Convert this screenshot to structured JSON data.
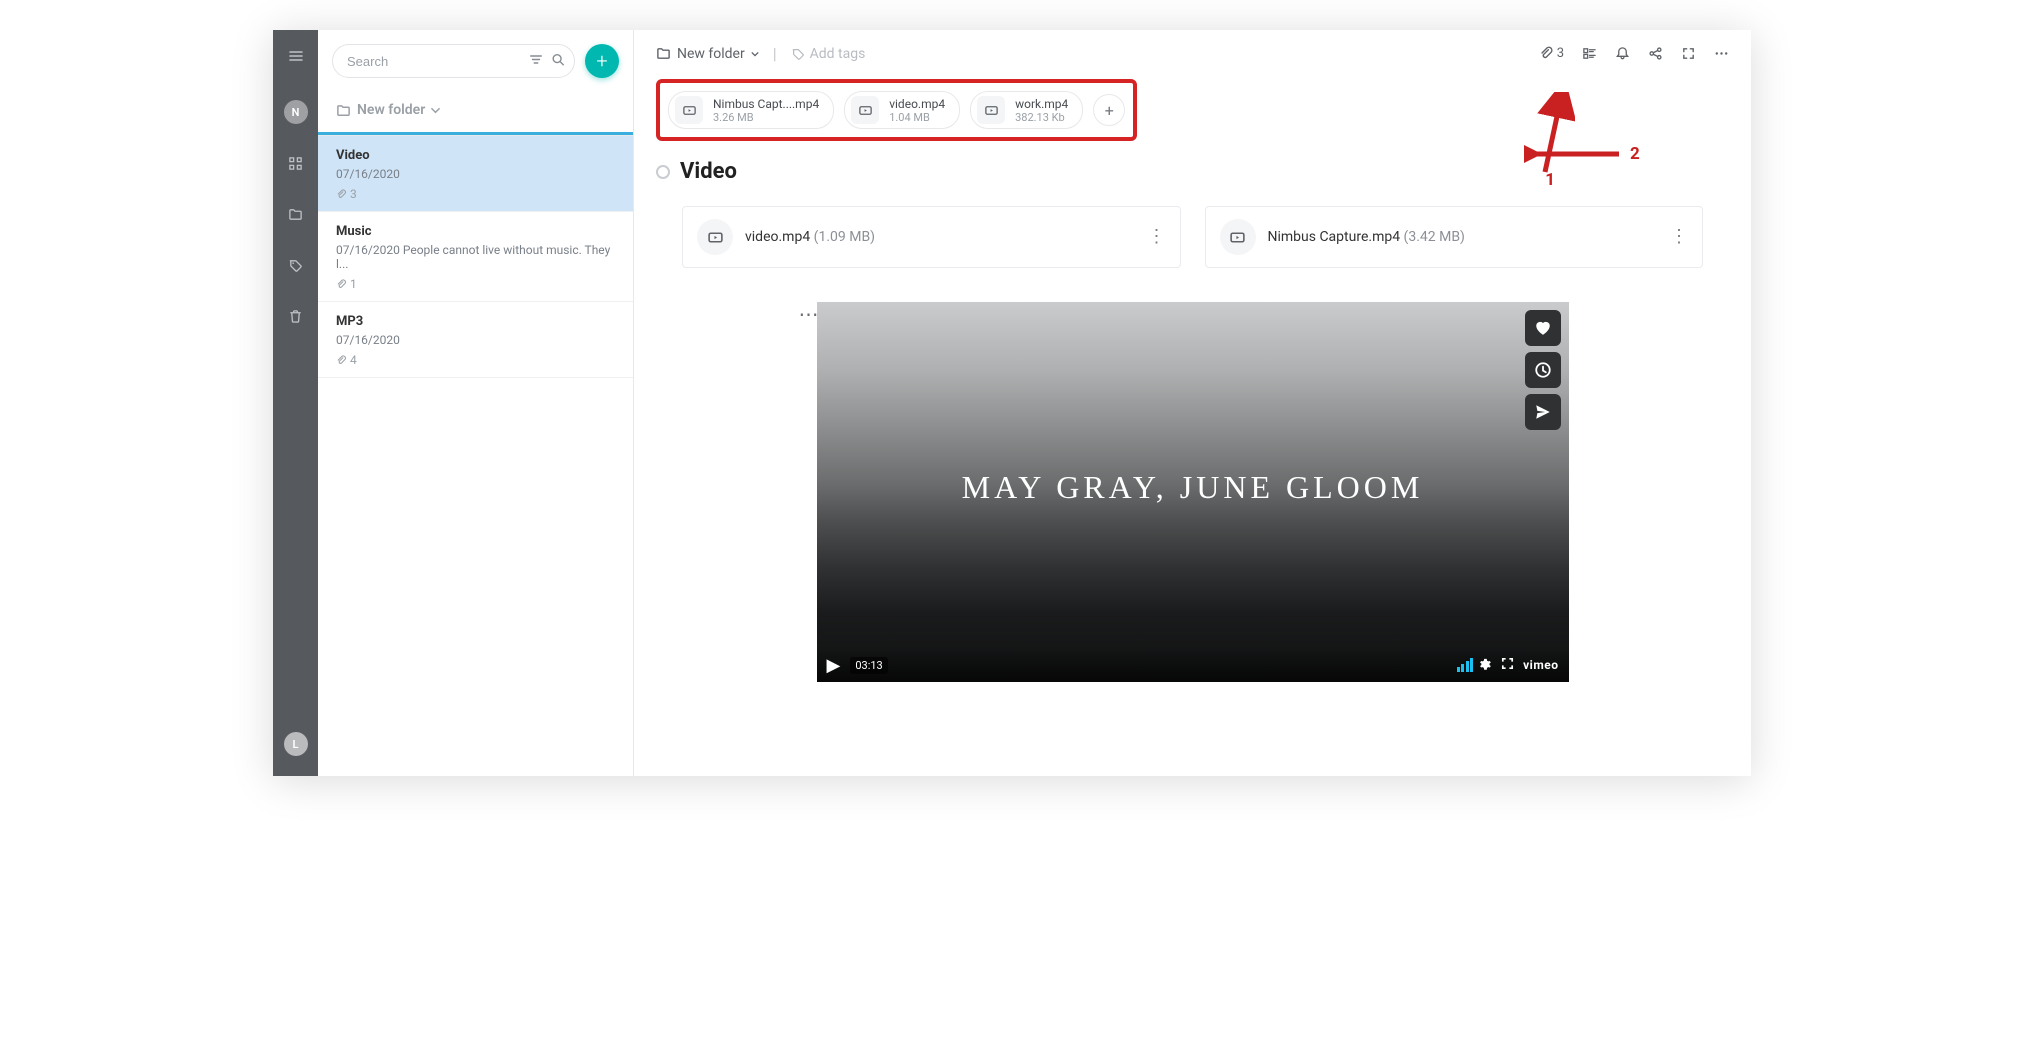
{
  "rail": {
    "avatar_top": "N",
    "avatar_bottom": "L"
  },
  "sidebar": {
    "search_placeholder": "Search",
    "breadcrumb_label": "New folder",
    "notes": [
      {
        "title": "Video",
        "date": "07/16/2020",
        "preview": "",
        "attach": "3",
        "selected": true
      },
      {
        "title": "Music",
        "date": "07/16/2020",
        "preview": "People cannot live without music. They l...",
        "attach": "1",
        "selected": false
      },
      {
        "title": "MP3",
        "date": "07/16/2020",
        "preview": "",
        "attach": "4",
        "selected": false
      }
    ]
  },
  "header": {
    "folder_label": "New folder",
    "add_tags": "Add tags",
    "attach_count": "3"
  },
  "chips": [
    {
      "name": "Nimbus Capt....mp4",
      "size": "3.26 MB"
    },
    {
      "name": "video.mp4",
      "size": "1.04 MB"
    },
    {
      "name": "work.mp4",
      "size": "382.13 Kb"
    }
  ],
  "note": {
    "title": "Video"
  },
  "file_cards": [
    {
      "name": "video.mp4",
      "size": "(1.09 MB)"
    },
    {
      "name": "Nimbus Capture.mp4",
      "size": "(3.42 MB)"
    }
  ],
  "video": {
    "overlay_title": "MAY GRAY, JUNE GLOOM",
    "duration": "03:13",
    "provider": "vimeo"
  },
  "annotations": {
    "label1": "1",
    "label2": "2"
  }
}
